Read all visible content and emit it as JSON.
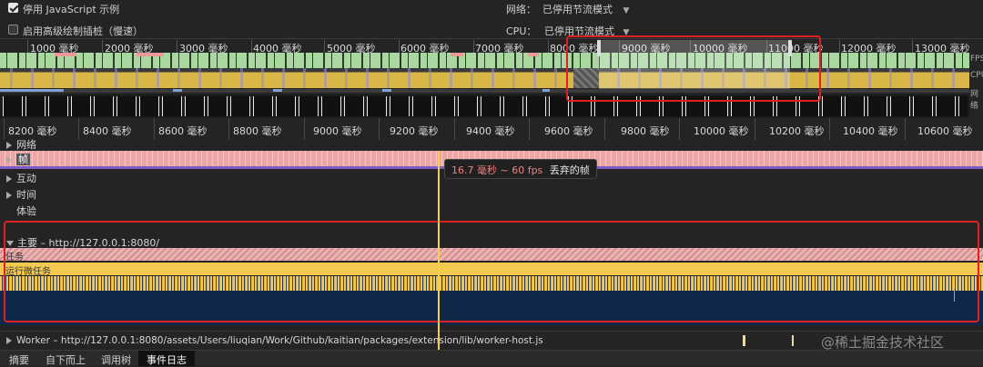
{
  "toolbar": {
    "disable_js_samples": {
      "label": "停用 JavaScript 示例",
      "checked": true
    },
    "advanced_paint": {
      "label": "启用高级绘制插桩（慢速）",
      "checked": false
    },
    "network_label": "网络：",
    "network_value": "已停用节流模式",
    "cpu_label": "CPU：",
    "cpu_value": "已停用节流模式"
  },
  "overview": {
    "ticks": [
      "1000 毫秒",
      "2000 毫秒",
      "3000 毫秒",
      "4000 毫秒",
      "5000 毫秒",
      "6000 毫秒",
      "7000 毫秒",
      "8000 毫秒",
      "9000 毫秒",
      "10000 毫秒",
      "11000 毫秒",
      "12000 毫秒",
      "13000 毫秒"
    ],
    "lane_labels": [
      "FPS",
      "CPU",
      "网络"
    ]
  },
  "ruler": {
    "ticks": [
      "8200 毫秒",
      "8400 毫秒",
      "8600 毫秒",
      "8800 毫秒",
      "9000 毫秒",
      "9200 毫秒",
      "9400 毫秒",
      "9600 毫秒",
      "9800 毫秒",
      "10000 毫秒",
      "10200 毫秒",
      "10400 毫秒",
      "10600 毫秒"
    ]
  },
  "tracks": {
    "network": "网络",
    "frames": "帧",
    "interactions": "互动",
    "timings": "时间",
    "experience": "体验",
    "main": "主要 – http://127.0.0.1:8080/",
    "worker": "Worker – http://127.0.0.1:8080/assets/Users/liuqian/Work/Github/kaitian/packages/extension/lib/worker-host.js"
  },
  "tooltip": {
    "time": "16.7 毫秒 ~ 60 fps",
    "text": "丢弃的帧"
  },
  "flame": {
    "task": "任务",
    "microtask": "运行微任务"
  },
  "watermark": "@稀土掘金技术社区",
  "tabs": [
    "摘要",
    "自下而上",
    "调用树",
    "事件日志"
  ],
  "active_tab": 3,
  "colors": {
    "highlight": "#e02020",
    "frame_drop": "#e9a7a7",
    "task": "#f3c94f",
    "main_bg": "#0f2748",
    "cursor": "#f6d04d"
  }
}
